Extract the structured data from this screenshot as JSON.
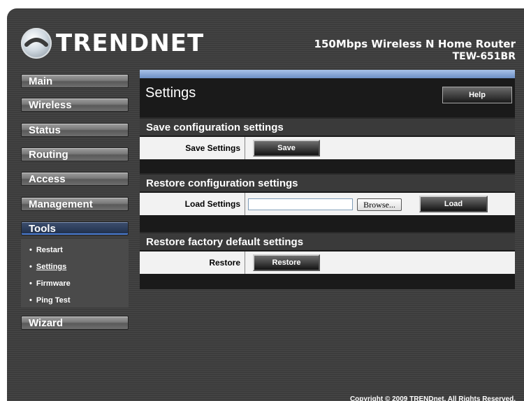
{
  "brand": {
    "logo_text": "TRENDNET"
  },
  "product": {
    "name": "150Mbps Wireless N Home Router",
    "model": "TEW-651BR"
  },
  "sidebar": {
    "items": [
      {
        "label": "Main"
      },
      {
        "label": "Wireless"
      },
      {
        "label": "Status"
      },
      {
        "label": "Routing"
      },
      {
        "label": "Access"
      },
      {
        "label": "Management"
      },
      {
        "label": "Tools",
        "active": true
      },
      {
        "label": "Wizard"
      }
    ],
    "tools_sub": [
      {
        "label": "Restart"
      },
      {
        "label": "Settings",
        "current": true
      },
      {
        "label": "Firmware"
      },
      {
        "label": "Ping Test"
      }
    ]
  },
  "page": {
    "title": "Settings",
    "help_label": "Help"
  },
  "sections": {
    "save": {
      "header": "Save configuration settings",
      "row_label": "Save Settings",
      "button": "Save"
    },
    "restore_config": {
      "header": "Restore configuration settings",
      "row_label": "Load Settings",
      "browse": "Browse...",
      "button": "Load",
      "file_value": ""
    },
    "factory": {
      "header": "Restore factory default settings",
      "row_label": "Restore",
      "button": "Restore"
    }
  },
  "footer": {
    "copyright": "Copyright © 2009 TRENDnet. All Rights Reserved."
  },
  "colors": {
    "accent_blue": "#6d8fc4",
    "background": "#3c3c3c",
    "row_bg": "#f2f2f2"
  }
}
